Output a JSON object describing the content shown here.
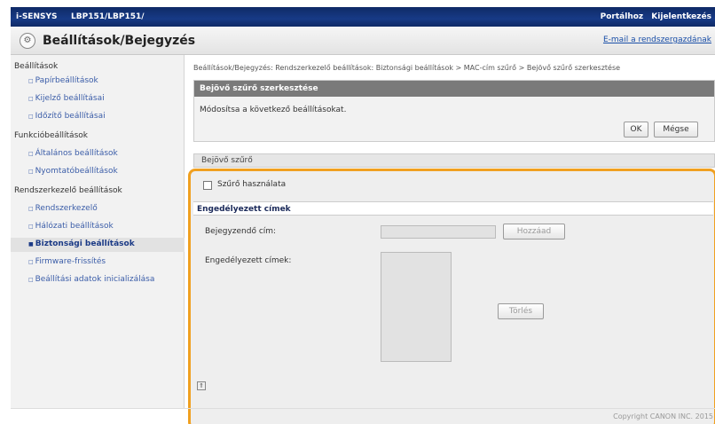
{
  "header": {
    "brand": "i-SENSYS",
    "model": "LBP151/LBP151/",
    "links": [
      "Portálhoz",
      "Kijelentkezés"
    ]
  },
  "titlebar": {
    "title": "Beállítások/Bejegyzés",
    "mail_link": "E-mail a rendszergazdának"
  },
  "sidebar": {
    "group1": "Beállítások",
    "items1": [
      "Papírbeállítások",
      "Kijelző beállításai",
      "Időzítő beállításai"
    ],
    "group2": "Funkcióbeállítások",
    "items2": [
      "Általános beállítások",
      "Nyomtatóbeállítások"
    ],
    "group3": "Rendszerkezelő beállítások",
    "items3": [
      "Rendszerkezelő",
      "Hálózati beállítások",
      "Biztonsági beállítások",
      "Firmware-frissítés",
      "Beállítási adatok inicializálása"
    ],
    "active_item": "Biztonsági beállítások"
  },
  "breadcrumb": "Beállítások/Bejegyzés: Rendszerkezelő beállítások: Biztonsági beállítások > MAC-cím szűrő > Bejövő szűrő szerkesztése",
  "edit_box": {
    "header": "Bejövő szűrő szerkesztése",
    "message": "Módosítsa a következő beállításokat.",
    "ok": "OK",
    "cancel": "Mégse"
  },
  "section": {
    "header": "Bejövő szűrő",
    "checkbox_label": "Szűrő használata",
    "checkbox_checked": false,
    "subheader": "Engedélyezett címek",
    "register_label": "Bejegyzendő cím:",
    "register_value": "",
    "add_button": "Hozzáad",
    "allowed_label": "Engedélyezett címek:",
    "delete_button": "Törlés"
  },
  "footer": {
    "copyright": "Copyright CANON INC. 2015"
  }
}
